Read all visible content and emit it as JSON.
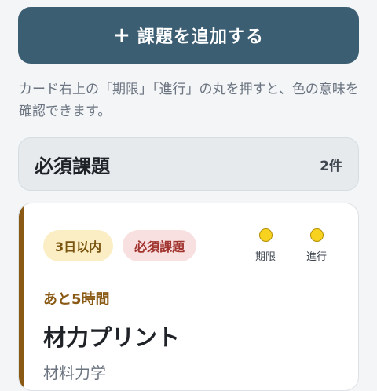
{
  "add_button": {
    "icon": "plus-icon",
    "label": "課題を追加する"
  },
  "hint_text": "カード右上の「期限」「進行」の丸を押すと、色の意味を確認できます。",
  "section": {
    "title": "必須課題",
    "count": "2件"
  },
  "card": {
    "badges": {
      "deadline": "3日以内",
      "category": "必須課題"
    },
    "indicators": [
      {
        "label": "期限",
        "color": "#f7d21e"
      },
      {
        "label": "進行",
        "color": "#f7d21e"
      }
    ],
    "remaining": "あと5時間",
    "title": "材力プリント",
    "subject": "材料力学",
    "accent_color": "#8a5a14"
  },
  "colors": {
    "primary_button": "#3c5e72",
    "background": "#f3f5f7"
  }
}
